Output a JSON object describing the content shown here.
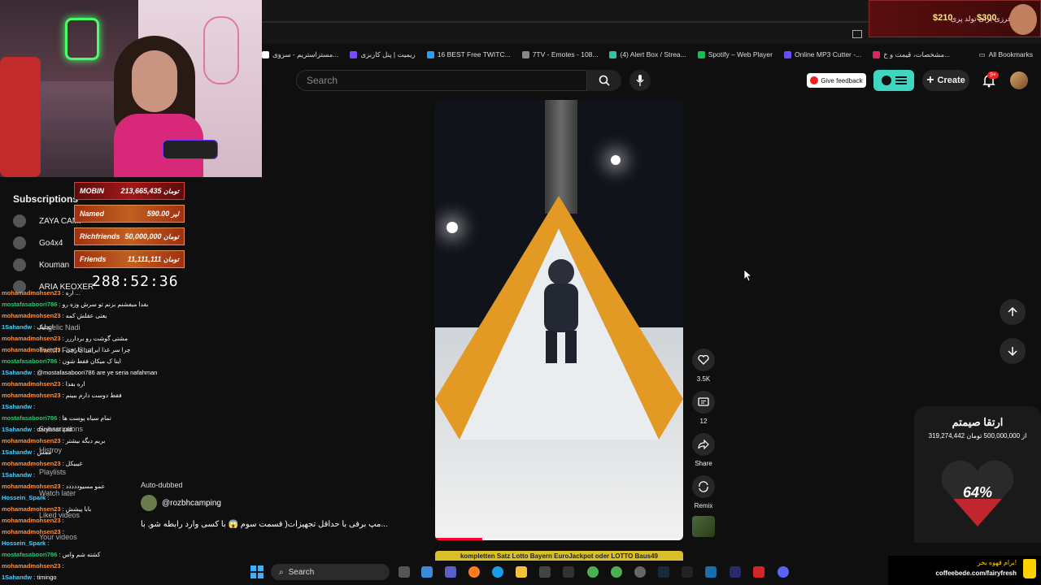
{
  "browser": {
    "bookmarks": [
      {
        "label": "مستراستریم - سروی...",
        "color": "#ffffff"
      },
      {
        "label": "ریمیت | پنل کاربری",
        "color": "#7a4cff"
      },
      {
        "label": "16 BEST Free TWITC...",
        "color": "#2a9df4"
      },
      {
        "label": "7TV - Emotes - 108...",
        "color": "#888888"
      },
      {
        "label": "(4) Alert Box / Strea...",
        "color": "#31c3a2"
      },
      {
        "label": "Spotify – Web Player",
        "color": "#1db954"
      },
      {
        "label": "Online MP3 Cutter -...",
        "color": "#6a4cff"
      },
      {
        "label": "مشخصات، قیمت و خ...",
        "color": "#e0245e"
      }
    ],
    "all_bookmarks_label": "All Bookmarks"
  },
  "header": {
    "search_placeholder": "Search",
    "feedback_label": "Give feedback",
    "create_label": "Create",
    "notif_badge": "9+"
  },
  "sidebar": {
    "title": "Subscriptions",
    "subscriptions": [
      "ZAYA CAMP",
      "Go4x4",
      "Kouman",
      "ARIA KEOXER"
    ]
  },
  "sidebar_ghost": [
    "Angelic Nadi",
    "Twitch First Chat",
    "Subscriptions",
    "Histroy",
    "Playlists",
    "Watch later",
    "Liked videos",
    "Your videos"
  ],
  "leaderboard": [
    {
      "name": "MOBIN",
      "amount": "213,665,435",
      "unit": "تومان"
    },
    {
      "name": "Named",
      "amount": "590.00",
      "unit": "لیر"
    },
    {
      "name": "Richfriends",
      "amount": "50,000,000",
      "unit": "تومان"
    },
    {
      "name": "Friends",
      "amount": "11,111,111",
      "unit": "تومان"
    }
  ],
  "timer": "288:52:36",
  "donation_bar": {
    "text": "فرزی برای تولد پری",
    "amount_raised": "$210",
    "amount_goal": "$300"
  },
  "chat": [
    {
      "user": "mohamadmohsen23",
      "msg": "اره ...",
      "cls": "u-c"
    },
    {
      "user": "mostafasaboori786",
      "msg": "بفدا میفشنم بزنم تو سرش وزه رو",
      "cls": "u-a"
    },
    {
      "user": "mohamadmohsen23",
      "msg": "یعنی عقلش کمه",
      "cls": "u-c"
    },
    {
      "user": "1Sahandw",
      "msg": "انجلیک",
      "cls": "u-b"
    },
    {
      "user": "mohamadmohsen23",
      "msg": "مشتی گوشت رو برداررر",
      "cls": "u-c"
    },
    {
      "user": "mohamadmohsen23",
      "msg": "چرا سر غذا ایرانی خارجی",
      "cls": "u-c"
    },
    {
      "user": "mostafasaboori786",
      "msg": "اینا ک میکان فقط شون",
      "cls": "u-a"
    },
    {
      "user": "1Sahandw",
      "msg": "@mostafasaboori786 are ye seria nafahman",
      "cls": "u-b"
    },
    {
      "user": "mohamadmohsen23",
      "msg": "اره بفدا",
      "cls": "u-c"
    },
    {
      "user": "mohamadmohsen23",
      "msg": "فقط دوست دارم ببینم",
      "cls": "u-c"
    },
    {
      "user": "1Sahandw",
      "msg": "",
      "cls": "u-b"
    },
    {
      "user": "mostafasaboori786",
      "msg": "تمام سیاه پوست ها",
      "cls": "u-a"
    },
    {
      "user": "1Sahandw",
      "msg": "daryanat zad",
      "cls": "u-b"
    },
    {
      "user": "mohamadmohsen23",
      "msg": "بریم دیگه بیشتر",
      "cls": "u-c"
    },
    {
      "user": "1Sahandw",
      "msg": "ممش",
      "cls": "u-b"
    },
    {
      "user": "mohamadmohsen23",
      "msg": "غیبیکل",
      "cls": "u-c"
    },
    {
      "user": "1Sahandw",
      "msg": "",
      "cls": "u-b"
    },
    {
      "user": "mohamadmohsen23",
      "msg": "عمو مسیوددددد",
      "cls": "u-c"
    },
    {
      "user": "Hossein_Spark",
      "msg": "",
      "cls": "u-b"
    },
    {
      "user": "mohamadmohsen23",
      "msg": "بابا پیشش",
      "cls": "u-c"
    },
    {
      "user": "mohamadmohsen23",
      "msg": "",
      "cls": "u-c"
    },
    {
      "user": "mohamadmohsen23",
      "msg": "",
      "cls": "u-c"
    },
    {
      "user": "Hossein_Spark",
      "msg": "",
      "cls": "u-b"
    },
    {
      "user": "mostafasaboori786",
      "msg": "کشته شم واس",
      "cls": "u-a"
    },
    {
      "user": "mohamadmohsen23",
      "msg": "",
      "cls": "u-c"
    },
    {
      "user": "1Sahandw",
      "msg": "timingo",
      "cls": "u-b"
    }
  ],
  "short": {
    "auto_dubbed": "Auto-dubbed",
    "channel": "@rozbhcamping",
    "title": "...مپ برفی با حداقل تجهیزات( قسمت سوم 😱 با کسی وارد رابطه شو, با",
    "likes": "3.5K",
    "comments": "12",
    "share_label": "Share",
    "remix_label": "Remix",
    "progress": 0.19,
    "next_strip": "kompletten Satz Lotto Bayern EuroJackpot oder LOTTO Baus49"
  },
  "goal": {
    "title": "ارتقا صیمتم",
    "amount": "319,274,442 از 500,000,000 تومان",
    "percent": "64%"
  },
  "coffee": {
    "line1": "برام قهوه بخر!",
    "line2": "coffeebede.com/fairyfresh"
  },
  "taskbar": {
    "search_label": "Search"
  },
  "colors": {
    "youtube_red": "#ff0033",
    "goal_heart": "#c0262e",
    "extension_teal": "#3ed6c1"
  }
}
